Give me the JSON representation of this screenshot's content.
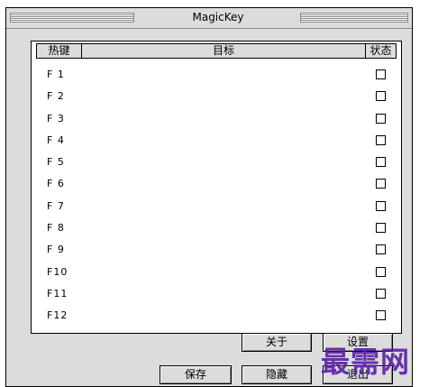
{
  "window": {
    "title": "MagicKey"
  },
  "table": {
    "headers": {
      "hotkey": "热键",
      "target": "目标",
      "status": "状态"
    },
    "rows": [
      {
        "key": "F 1",
        "target": "",
        "checked": false
      },
      {
        "key": "F 2",
        "target": "",
        "checked": false
      },
      {
        "key": "F 3",
        "target": "",
        "checked": false
      },
      {
        "key": "F 4",
        "target": "",
        "checked": false
      },
      {
        "key": "F 5",
        "target": "",
        "checked": false
      },
      {
        "key": "F 6",
        "target": "",
        "checked": false
      },
      {
        "key": "F 7",
        "target": "",
        "checked": false
      },
      {
        "key": "F 8",
        "target": "",
        "checked": false
      },
      {
        "key": "F 9",
        "target": "",
        "checked": false
      },
      {
        "key": "F10",
        "target": "",
        "checked": false
      },
      {
        "key": "F11",
        "target": "",
        "checked": false
      },
      {
        "key": "F12",
        "target": "",
        "checked": false
      }
    ]
  },
  "buttons": {
    "about": "关于",
    "settings": "设置",
    "save": "保存",
    "hide": "隐藏",
    "exit": "退出"
  },
  "watermark": "最需网"
}
